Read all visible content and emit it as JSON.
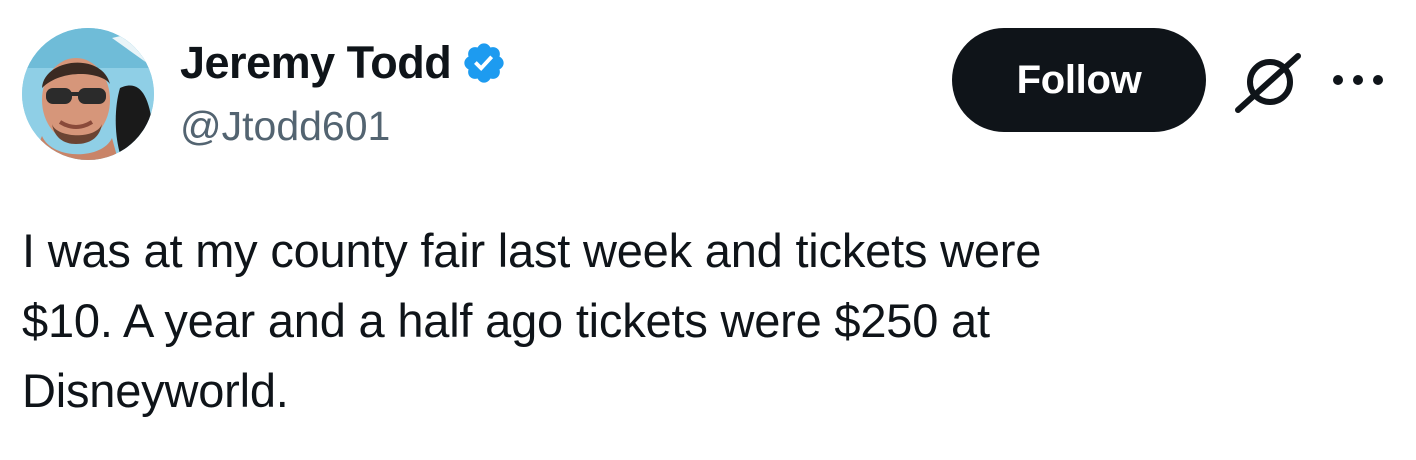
{
  "author": {
    "display_name": "Jeremy Todd",
    "handle": "@Jtodd601",
    "verified": true,
    "verified_color": "#1d9bf0"
  },
  "actions": {
    "follow_label": "Follow",
    "grok_icon": "grok-icon",
    "more_icon": "more-dots-icon"
  },
  "tweet": {
    "text": "I was at my county fair last week and tickets were\n$10. A year and a half ago tickets were $250 at\nDisneyworld."
  },
  "colors": {
    "text_primary": "#0f1419",
    "text_secondary": "#536471",
    "button_bg": "#0f1419",
    "button_text": "#ffffff"
  }
}
